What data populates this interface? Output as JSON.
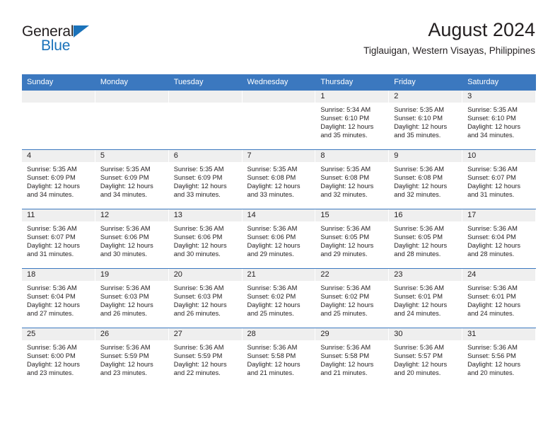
{
  "brand": {
    "name_top": "General",
    "name_bottom": "Blue",
    "triangle_color": "#1a72ba",
    "blue_text_color": "#1a72ba",
    "black_text_color": "#231f20"
  },
  "header": {
    "title": "August 2024",
    "subtitle": "Tiglauigan, Western Visayas, Philippines"
  },
  "theme": {
    "header_bar_color": "#3b78bf",
    "daynum_band_color": "#efefef",
    "row_rule_color": "#3b78bf",
    "text_color": "#231f20"
  },
  "weekday_headers": [
    "Sunday",
    "Monday",
    "Tuesday",
    "Wednesday",
    "Thursday",
    "Friday",
    "Saturday"
  ],
  "weeks": [
    [
      {
        "day": "",
        "lines": []
      },
      {
        "day": "",
        "lines": []
      },
      {
        "day": "",
        "lines": []
      },
      {
        "day": "",
        "lines": []
      },
      {
        "day": "1",
        "lines": [
          "Sunrise: 5:34 AM",
          "Sunset: 6:10 PM",
          "Daylight: 12 hours",
          "and 35 minutes."
        ]
      },
      {
        "day": "2",
        "lines": [
          "Sunrise: 5:35 AM",
          "Sunset: 6:10 PM",
          "Daylight: 12 hours",
          "and 35 minutes."
        ]
      },
      {
        "day": "3",
        "lines": [
          "Sunrise: 5:35 AM",
          "Sunset: 6:10 PM",
          "Daylight: 12 hours",
          "and 34 minutes."
        ]
      }
    ],
    [
      {
        "day": "4",
        "lines": [
          "Sunrise: 5:35 AM",
          "Sunset: 6:09 PM",
          "Daylight: 12 hours",
          "and 34 minutes."
        ]
      },
      {
        "day": "5",
        "lines": [
          "Sunrise: 5:35 AM",
          "Sunset: 6:09 PM",
          "Daylight: 12 hours",
          "and 34 minutes."
        ]
      },
      {
        "day": "6",
        "lines": [
          "Sunrise: 5:35 AM",
          "Sunset: 6:09 PM",
          "Daylight: 12 hours",
          "and 33 minutes."
        ]
      },
      {
        "day": "7",
        "lines": [
          "Sunrise: 5:35 AM",
          "Sunset: 6:08 PM",
          "Daylight: 12 hours",
          "and 33 minutes."
        ]
      },
      {
        "day": "8",
        "lines": [
          "Sunrise: 5:35 AM",
          "Sunset: 6:08 PM",
          "Daylight: 12 hours",
          "and 32 minutes."
        ]
      },
      {
        "day": "9",
        "lines": [
          "Sunrise: 5:36 AM",
          "Sunset: 6:08 PM",
          "Daylight: 12 hours",
          "and 32 minutes."
        ]
      },
      {
        "day": "10",
        "lines": [
          "Sunrise: 5:36 AM",
          "Sunset: 6:07 PM",
          "Daylight: 12 hours",
          "and 31 minutes."
        ]
      }
    ],
    [
      {
        "day": "11",
        "lines": [
          "Sunrise: 5:36 AM",
          "Sunset: 6:07 PM",
          "Daylight: 12 hours",
          "and 31 minutes."
        ]
      },
      {
        "day": "12",
        "lines": [
          "Sunrise: 5:36 AM",
          "Sunset: 6:06 PM",
          "Daylight: 12 hours",
          "and 30 minutes."
        ]
      },
      {
        "day": "13",
        "lines": [
          "Sunrise: 5:36 AM",
          "Sunset: 6:06 PM",
          "Daylight: 12 hours",
          "and 30 minutes."
        ]
      },
      {
        "day": "14",
        "lines": [
          "Sunrise: 5:36 AM",
          "Sunset: 6:06 PM",
          "Daylight: 12 hours",
          "and 29 minutes."
        ]
      },
      {
        "day": "15",
        "lines": [
          "Sunrise: 5:36 AM",
          "Sunset: 6:05 PM",
          "Daylight: 12 hours",
          "and 29 minutes."
        ]
      },
      {
        "day": "16",
        "lines": [
          "Sunrise: 5:36 AM",
          "Sunset: 6:05 PM",
          "Daylight: 12 hours",
          "and 28 minutes."
        ]
      },
      {
        "day": "17",
        "lines": [
          "Sunrise: 5:36 AM",
          "Sunset: 6:04 PM",
          "Daylight: 12 hours",
          "and 28 minutes."
        ]
      }
    ],
    [
      {
        "day": "18",
        "lines": [
          "Sunrise: 5:36 AM",
          "Sunset: 6:04 PM",
          "Daylight: 12 hours",
          "and 27 minutes."
        ]
      },
      {
        "day": "19",
        "lines": [
          "Sunrise: 5:36 AM",
          "Sunset: 6:03 PM",
          "Daylight: 12 hours",
          "and 26 minutes."
        ]
      },
      {
        "day": "20",
        "lines": [
          "Sunrise: 5:36 AM",
          "Sunset: 6:03 PM",
          "Daylight: 12 hours",
          "and 26 minutes."
        ]
      },
      {
        "day": "21",
        "lines": [
          "Sunrise: 5:36 AM",
          "Sunset: 6:02 PM",
          "Daylight: 12 hours",
          "and 25 minutes."
        ]
      },
      {
        "day": "22",
        "lines": [
          "Sunrise: 5:36 AM",
          "Sunset: 6:02 PM",
          "Daylight: 12 hours",
          "and 25 minutes."
        ]
      },
      {
        "day": "23",
        "lines": [
          "Sunrise: 5:36 AM",
          "Sunset: 6:01 PM",
          "Daylight: 12 hours",
          "and 24 minutes."
        ]
      },
      {
        "day": "24",
        "lines": [
          "Sunrise: 5:36 AM",
          "Sunset: 6:01 PM",
          "Daylight: 12 hours",
          "and 24 minutes."
        ]
      }
    ],
    [
      {
        "day": "25",
        "lines": [
          "Sunrise: 5:36 AM",
          "Sunset: 6:00 PM",
          "Daylight: 12 hours",
          "and 23 minutes."
        ]
      },
      {
        "day": "26",
        "lines": [
          "Sunrise: 5:36 AM",
          "Sunset: 5:59 PM",
          "Daylight: 12 hours",
          "and 23 minutes."
        ]
      },
      {
        "day": "27",
        "lines": [
          "Sunrise: 5:36 AM",
          "Sunset: 5:59 PM",
          "Daylight: 12 hours",
          "and 22 minutes."
        ]
      },
      {
        "day": "28",
        "lines": [
          "Sunrise: 5:36 AM",
          "Sunset: 5:58 PM",
          "Daylight: 12 hours",
          "and 21 minutes."
        ]
      },
      {
        "day": "29",
        "lines": [
          "Sunrise: 5:36 AM",
          "Sunset: 5:58 PM",
          "Daylight: 12 hours",
          "and 21 minutes."
        ]
      },
      {
        "day": "30",
        "lines": [
          "Sunrise: 5:36 AM",
          "Sunset: 5:57 PM",
          "Daylight: 12 hours",
          "and 20 minutes."
        ]
      },
      {
        "day": "31",
        "lines": [
          "Sunrise: 5:36 AM",
          "Sunset: 5:56 PM",
          "Daylight: 12 hours",
          "and 20 minutes."
        ]
      }
    ]
  ]
}
